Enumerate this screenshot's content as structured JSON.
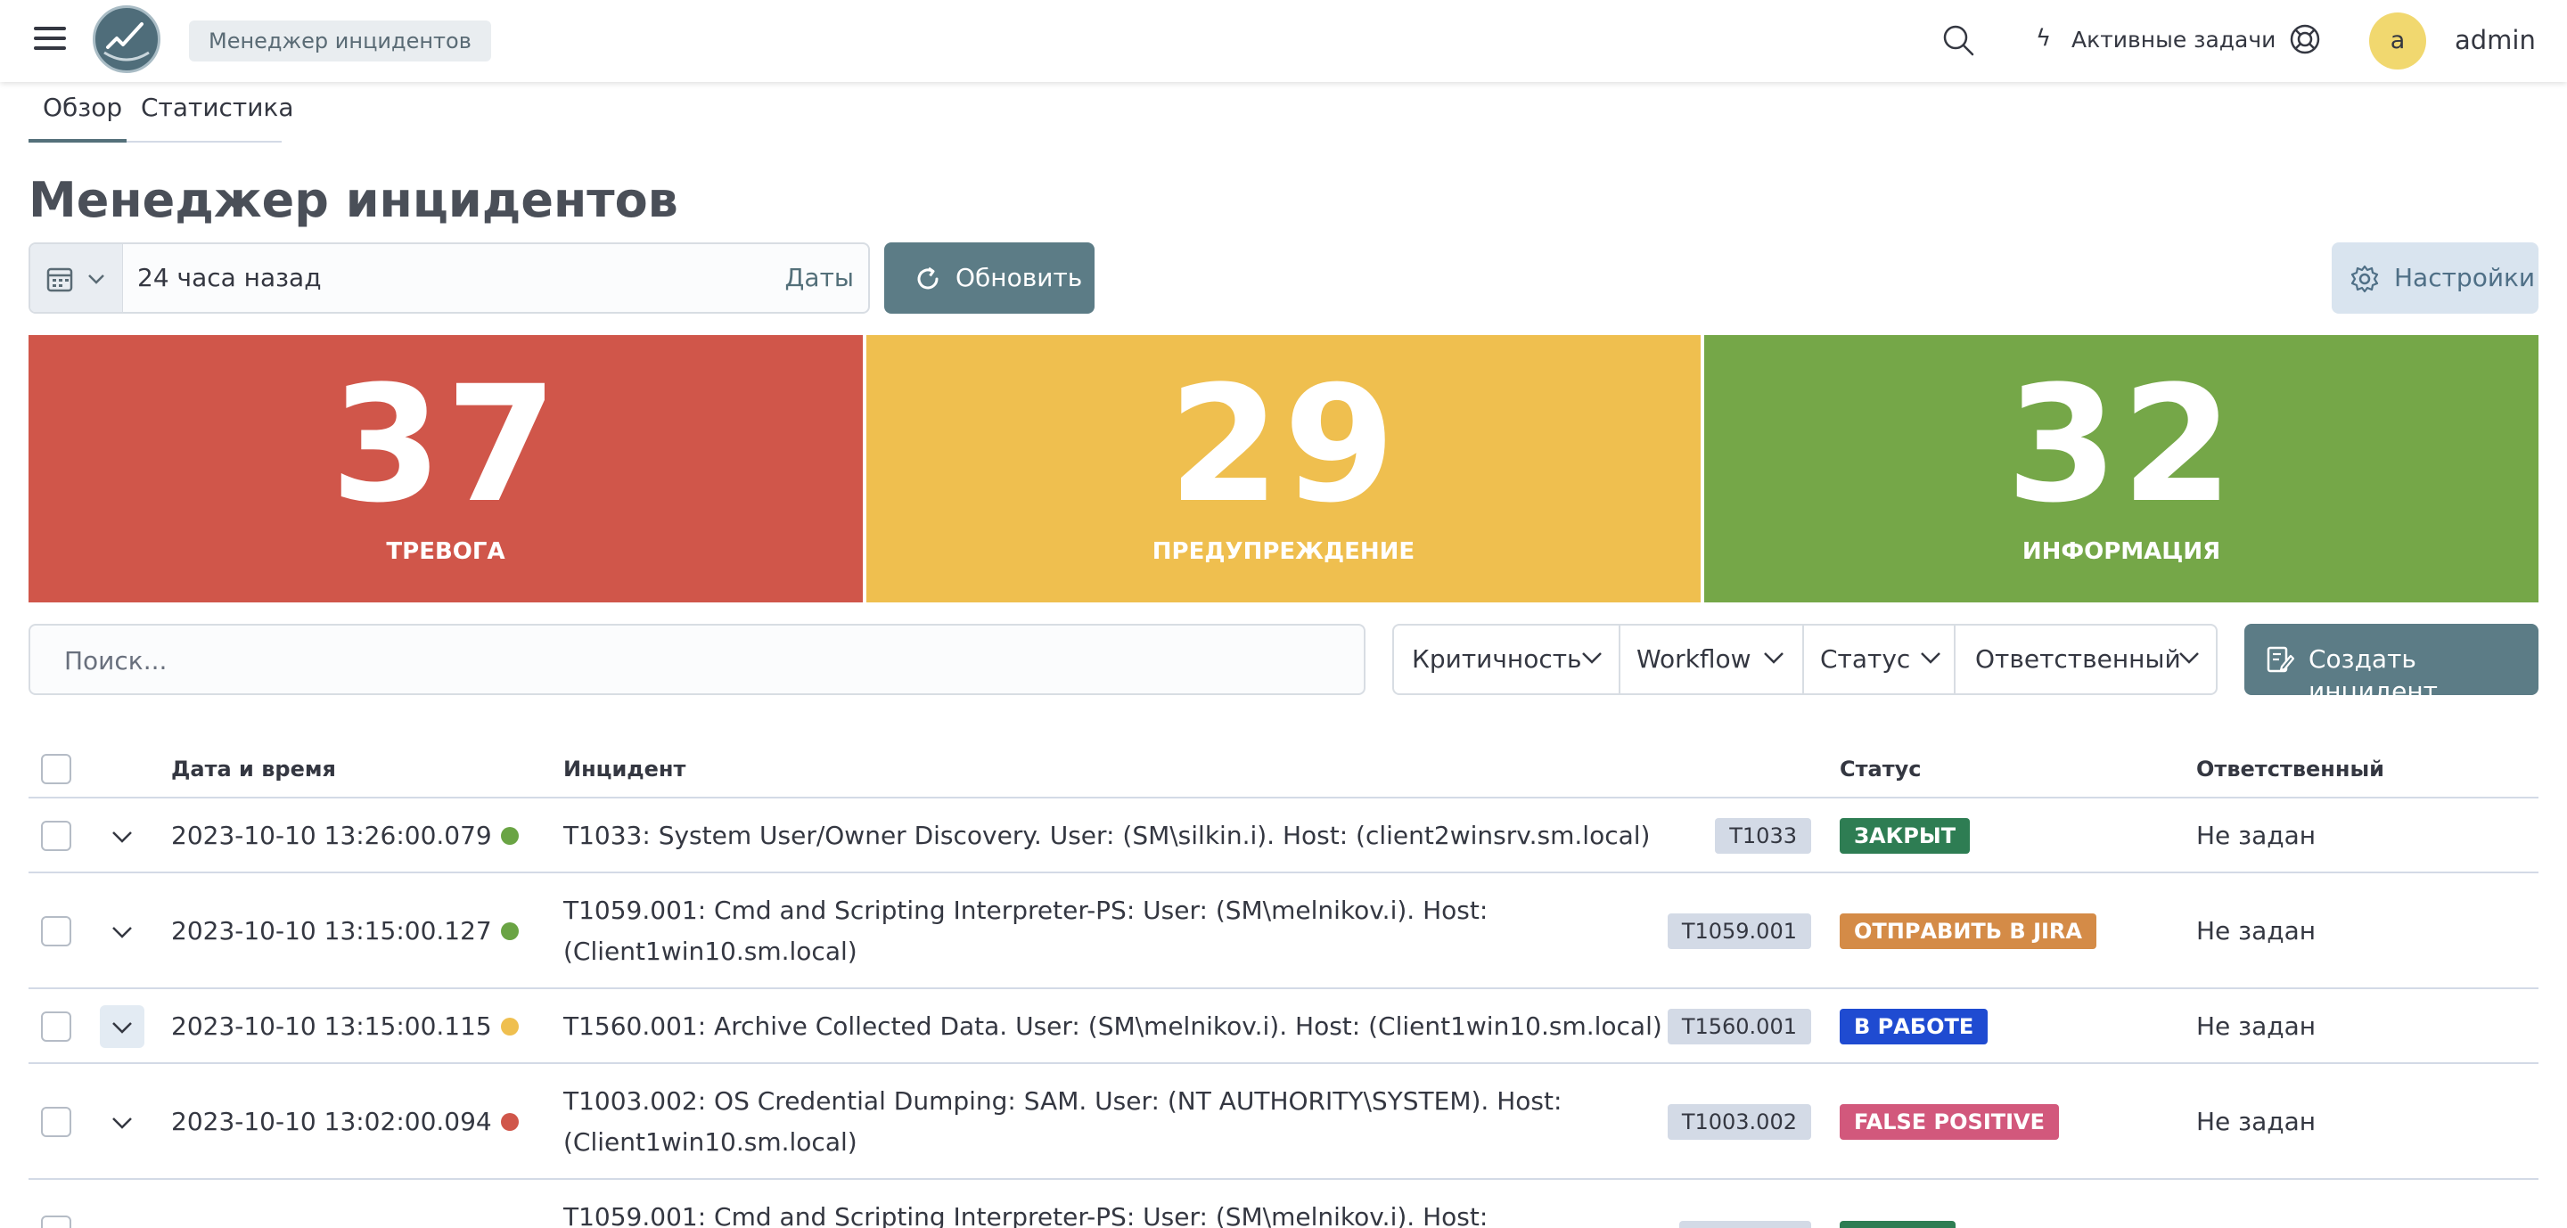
{
  "header": {
    "breadcrumb": "Менеджер инцидентов",
    "active_tasks": "Активные задачи",
    "avatar_letter": "a",
    "username": "admin",
    "icons": [
      "menu-icon",
      "logo-icon",
      "search-icon",
      "bolt-icon",
      "help-icon"
    ]
  },
  "tabs": [
    {
      "label": "Обзор",
      "active": true
    },
    {
      "label": "Статистика",
      "active": false
    }
  ],
  "page_title": "Менеджер инцидентов",
  "date_picker": {
    "value": "24 часа назад",
    "dates_link": "Даты"
  },
  "buttons": {
    "refresh": "Обновить",
    "settings": "Настройки",
    "create": "Создать инцидент"
  },
  "stats": [
    {
      "value": "37",
      "label": "ТРЕВОГА",
      "color": "#d0564a"
    },
    {
      "value": "29",
      "label": "ПРЕДУПРЕЖДЕНИЕ",
      "color": "#efbf4f"
    },
    {
      "value": "32",
      "label": "ИНФОРМАЦИЯ",
      "color": "#75a748"
    }
  ],
  "search": {
    "placeholder": "Поиск..."
  },
  "filters": [
    "Критичность",
    "Workflow",
    "Статус",
    "Ответственный"
  ],
  "table": {
    "headers": {
      "datetime": "Дата и время",
      "incident": "Инцидент",
      "status": "Статус",
      "owner": "Ответственный"
    },
    "rows": [
      {
        "datetime": "2023-10-10 13:26:00.079",
        "severity_color": "#6aa444",
        "incident_line1": "T1033: System User/Owner Discovery. User: (SM\\silkin.i). Host: (client2winsrv.sm.local)",
        "incident_line2": "",
        "tag": "T1033",
        "status": "ЗАКРЫТ",
        "status_color": "#2e7d53",
        "owner": "Не задан"
      },
      {
        "datetime": "2023-10-10 13:15:00.127",
        "severity_color": "#6aa444",
        "incident_line1": "T1059.001: Cmd and Scripting Interpreter-PS: User: (SM\\melnikov.i). Host:",
        "incident_line2": "(Client1win10.sm.local)",
        "tag": "T1059.001",
        "status": "ОТПРАВИТЬ В JIRA",
        "status_color": "#d48b47",
        "owner": "Не задан"
      },
      {
        "datetime": "2023-10-10 13:15:00.115",
        "severity_color": "#efbf4f",
        "incident_line1": "T1560.001: Archive Collected Data. User: (SM\\melnikov.i). Host: (Client1win10.sm.local)",
        "incident_line2": "",
        "tag": "T1560.001",
        "status": "В РАБОТЕ",
        "status_color": "#1f4bd1",
        "owner": "Не задан"
      },
      {
        "datetime": "2023-10-10 13:02:00.094",
        "severity_color": "#d0564a",
        "incident_line1": "T1003.002: OS Credential Dumping: SAM. User: (NT AUTHORITY\\SYSTEM). Host:",
        "incident_line2": "(Client1win10.sm.local)",
        "tag": "T1003.002",
        "status": "FALSE POSITIVE",
        "status_color": "#d2587c",
        "owner": "Не задан"
      },
      {
        "datetime": "",
        "severity_color": "",
        "incident_line1": "T1059.001: Cmd and Scripting Interpreter-PS: User: (SM\\melnikov.i). Host:",
        "incident_line2": "",
        "tag": "",
        "status": "",
        "status_color": "#2e7d53",
        "owner": ""
      }
    ]
  }
}
